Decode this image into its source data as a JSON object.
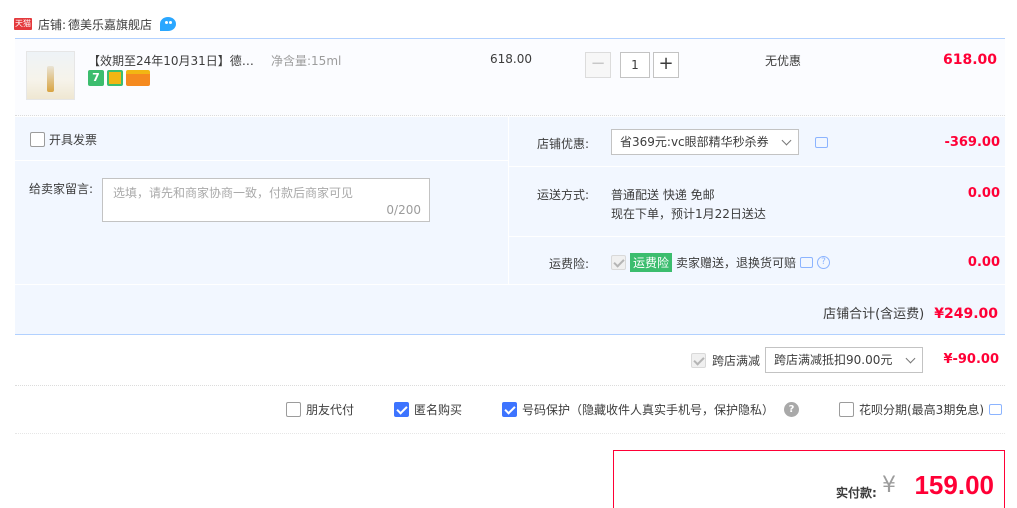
{
  "store": {
    "badge": "天猫",
    "label": "店铺:",
    "name": "德美乐嘉旗舰店"
  },
  "item": {
    "title": "【效期至24年10月31日】德美...",
    "sku": "净含量:15ml",
    "unit_price": "618.00",
    "quantity": "1",
    "minus": "−",
    "plus": "+",
    "promo": "无优惠",
    "total": "618.00",
    "service_icons": [
      "7-day-return-icon",
      "guarantee-icon",
      "card-icon"
    ]
  },
  "options": {
    "invoice_label": "开具发票",
    "message_label": "给卖家留言:",
    "message_placeholder": "选填，请先和商家协商一致，付款后商家可见",
    "message_count": "0/200",
    "discount_label": "店铺优惠:",
    "discount_value": "省369元:vc眼部精华秒杀券",
    "discount_amount": "-369.00",
    "shipping_label": "运送方式:",
    "shipping_method": "普通配送 快递 免邮",
    "shipping_eta": "现在下单，预计1月22日送达",
    "shipping_amount": "0.00",
    "insurance_label": "运费险:",
    "insurance_tag": "运费险",
    "insurance_text": "卖家赠送，退换货可赔",
    "insurance_amount": "0.00",
    "store_total_label": "店铺合计(含运费)",
    "store_total_value": "¥249.00"
  },
  "cross_store": {
    "label": "跨店满减",
    "select_value": "跨店满减抵扣90.00元",
    "amount": "¥-90.00"
  },
  "bottom_options": {
    "friend_pay": "朋友代付",
    "anonymous": "匿名购买",
    "number_protect": "号码保护（隐藏收件人真实手机号，保护隐私）",
    "huabei": "花呗分期(最高3期免息)"
  },
  "payment": {
    "label": "实付款:",
    "currency": "¥",
    "amount": "159.00"
  },
  "colors": {
    "accent_red": "#ff0036",
    "accent_blue": "#3d74ff",
    "panel_bg": "#f2f7ff"
  }
}
